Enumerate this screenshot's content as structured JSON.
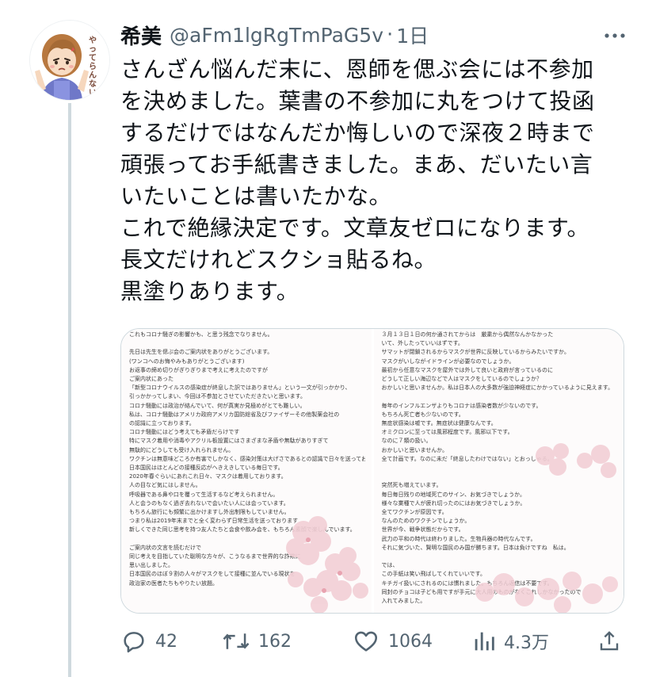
{
  "tweet": {
    "display_name": "希美",
    "handle": "@aFm1lgRgTmPaG5v",
    "separator": "·",
    "time": "1日",
    "avatar_icon": "girl-avatar-icon",
    "avatar_text": "やってらんないわ",
    "text_lines": [
      "さんざん悩んだ末に、恩師を偲ぶ会には不参加",
      "を決めました。葉書の不参加に丸をつけて投函",
      "するだけではなんだか悔しいので深夜２時まで",
      "頑張ってお手紙書きました。まあ、だいたい言",
      "いたいことは書いたかな。",
      "これで絶縁決定です。文章友ゼロになります。",
      "長文だけれどスクショ貼るね。",
      "黒塗りあります。"
    ]
  },
  "media": {
    "left_lines": [
      "これもコロナ騒ぎの影響かも、と思う残念でなりません。",
      "",
      "先日は先生を偲ぶ会のご案内状をありがとうございます。",
      "(ワンコへのお悔やみもありがとうございます)",
      "お返事の締め切りがぎりぎりまで考えに考えたのですが",
      "ご案内状にあった",
      "「新型コロナウイルスの感染症が終息した訳ではありません」という一文が引っかかり、",
      "引っかかってしまい、今回は不参加とさせていただきたいと思います。",
      "コロナ騒動には政治が絡んでいて、何が真実か見極めがとても難しい。",
      "私は、コロナ騒動はアメリカ政府アメリカ国防総省及びファイザーその他製薬会社の",
      "の認識に立っております。",
      "コロナ騒動にはどう考えても矛盾だらけです",
      "特にマスク着用や消毒やアクリル板設置にはさまざまな矛盾や無駄がありすぎて",
      "無駄的にどうしても受け入れられません。",
      "ワクチンは無意味どころか有害でしかなく、感染対策は大げさであるとの認識で日々を送っております",
      "日本国民はほとんどの接種反応がへきえきしている毎日です。",
      "2020年春ぐらいにあれこれ日々、マスクは着用しております。",
      "人の目など気にはしません。",
      "呼吸器である鼻や口を覆って生活するなど考えられません。",
      "人と会うのもなく過ぎ去れないで会いたい人には会っています。",
      "もちろん旅行にも頻繁に出かけますし外出制限もしていません。",
      "つまり私は2019年末までと全く変わらず日常生活を送っております",
      "新しくできた同じ思考を持つ友人たちと会食や飲み会を、もちろん素顔で楽しんでいます。",
      "",
      "ご案内状の文言を読むだけで",
      "同じ考えを目指していた聡明な方々が、こうなるまで世界的な詐欺に",
      "思い出しました。",
      "日本国民のほぼ９割の人々がマスクをして接種に並んでいる現状を",
      "政治家の医者たちもやりたい放題。"
    ],
    "right_lines": [
      "３月１３日１日の何か通されてからは　厳粛から偶然なんかなかった",
      "いて、外したっていいはずです。",
      "サマットが閉鎖されるからマスクが世界に反映しているからみたいですか。",
      "マスクがいしながイドラインが必要なのでしょうか。",
      "最初から任意なマスクを屋外では外して良いと政府が言っているのに",
      "どうして正しい海辺などで人はマスクをしているのでしょうか？",
      "おかしいと思いませんか。私は日本人の大多数が強迫神経症にかかっているように見えます。",
      "",
      "毎年のインフルエンザよりもコロナは感染者数が少ないのです。",
      "もちろん死亡者も少ないのです。",
      "無症状感染は嘘です。無症状は健康なんです。",
      "オミクロンに至っては風邪程度です。風邪以下です。",
      "なのに７類の扱い。",
      "おかしいと思いませんか。",
      "全て計画です。なのに未だ「終息したわけではない」とおっしゃる。",
      "",
      "",
      "突然死も増えています。",
      "毎日毎日残りの地域死亡のサイン、お気づきでしょうか。",
      "様々な業種で人が疲れ切ったのにはお気づきでしょうか。",
      "全てワクチンが原因です。",
      "なんのためのワクチンでしょうか。",
      "世界が今、戦争状態だからです。",
      "武力の平和の時代は終わりました。生物兵器の時代なんです。",
      "それに気づいた、賢明な国民のみ国が勝ちます。日本は負けですね　私は。",
      "",
      "では、",
      "この手紙は笑い飛ばしてくれていいです。",
      "キチガイ扱いにされるのには慣れました。もちろん返信は不要です。",
      "同封のチョコは子ども用ですが手元に大人用のものがなくこれしかなかったので",
      "入れてみました。"
    ]
  },
  "actions": {
    "reply": {
      "icon": "reply-icon",
      "count": "42"
    },
    "retweet": {
      "icon": "retweet-icon",
      "count": "162"
    },
    "like": {
      "icon": "heart-icon",
      "count": "1064"
    },
    "views": {
      "icon": "views-icon",
      "count": "4.3万"
    },
    "share": {
      "icon": "share-icon"
    }
  },
  "colors": {
    "text": "#0f1419",
    "secondary": "#536471",
    "border": "#cfd9de",
    "avatar_text": "#7a4a3a"
  }
}
